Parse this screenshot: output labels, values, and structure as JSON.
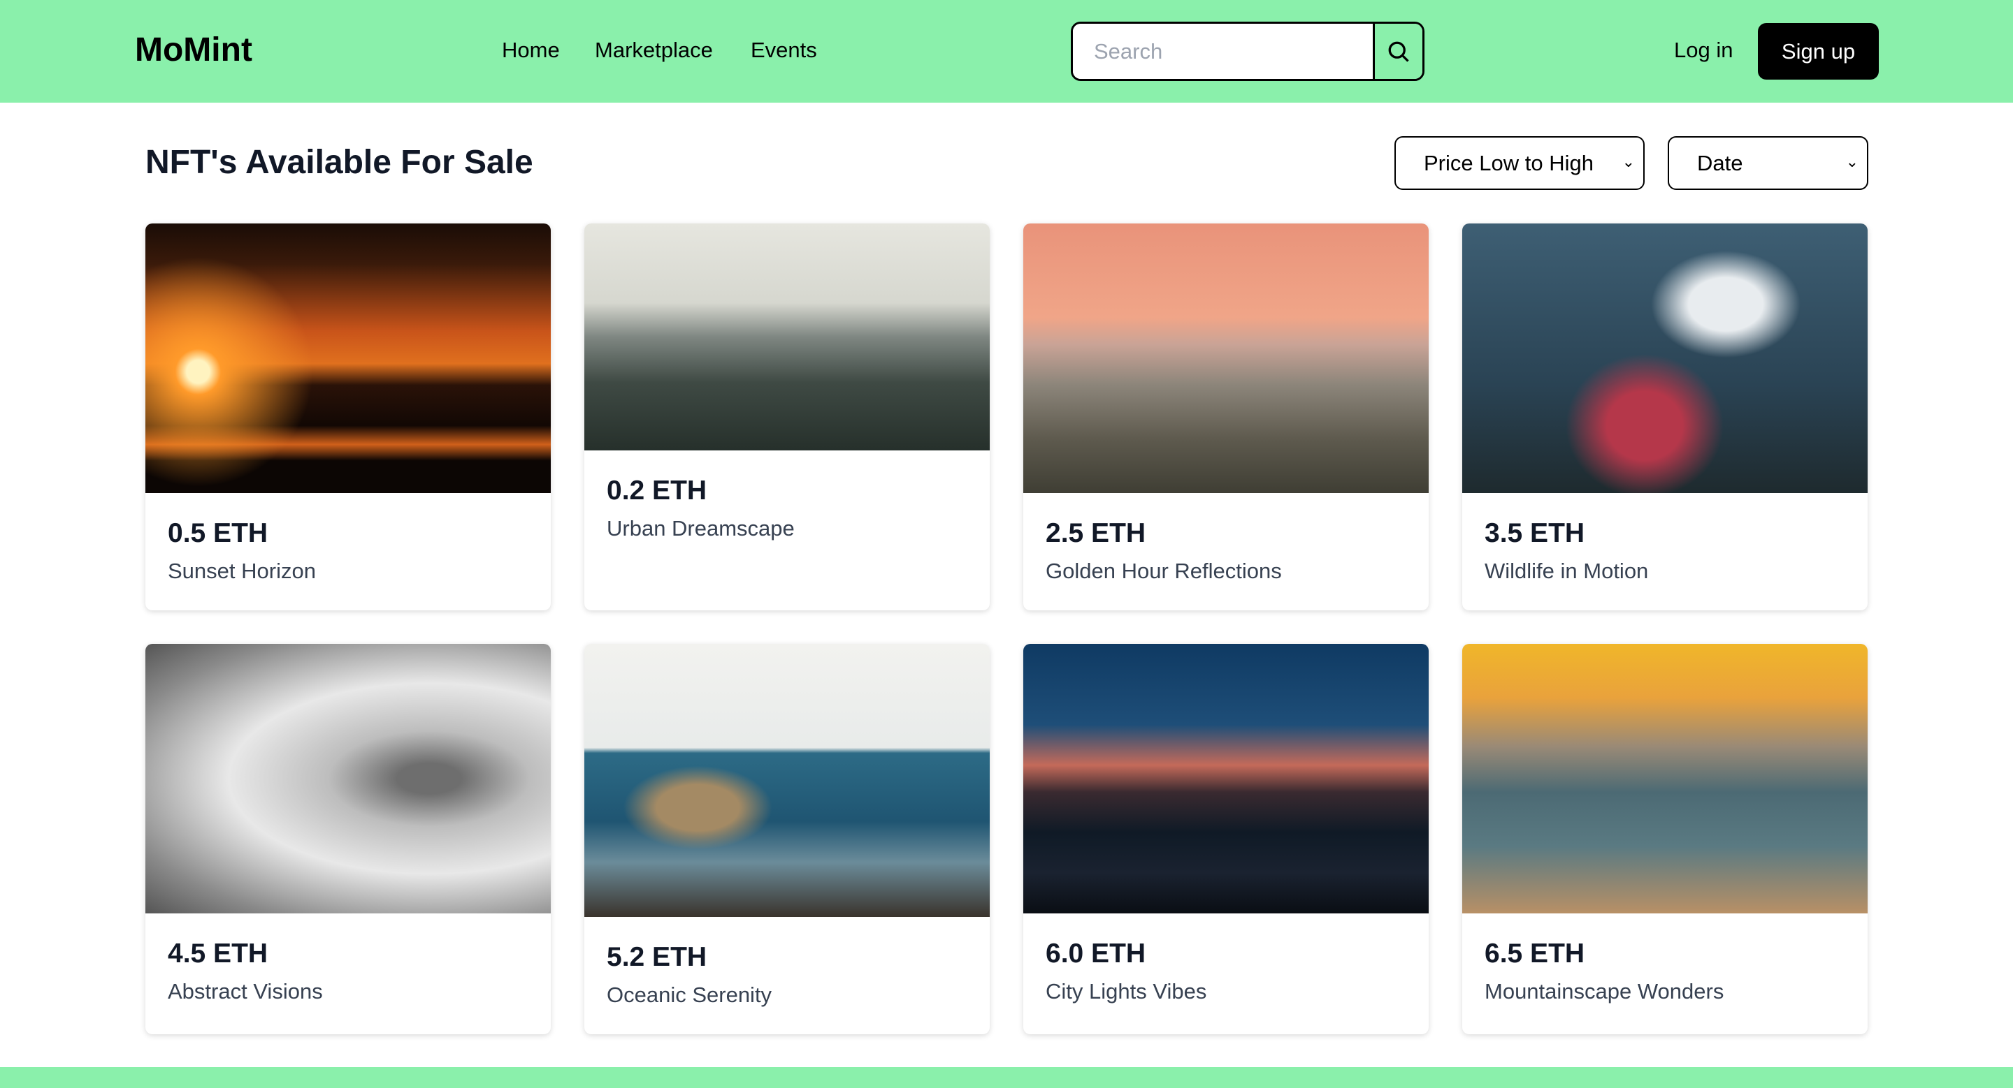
{
  "header": {
    "logo": "MoMint",
    "nav": [
      "Home",
      "Marketplace",
      "Events"
    ],
    "search_placeholder": "Search",
    "login": "Log in",
    "signup": "Sign up",
    "brand_color": "#8af0ab"
  },
  "main": {
    "title": "NFT's Available For Sale",
    "sort_select": "Price Low to High",
    "filter_select": "Date"
  },
  "cards": [
    {
      "price": "0.5 ETH",
      "name": "Sunset Horizon"
    },
    {
      "price": "0.2 ETH",
      "name": "Urban Dreamscape"
    },
    {
      "price": "2.5 ETH",
      "name": "Golden Hour Reflections"
    },
    {
      "price": "3.5 ETH",
      "name": "Wildlife in Motion"
    },
    {
      "price": "4.5 ETH",
      "name": "Abstract Visions"
    },
    {
      "price": "5.2 ETH",
      "name": "Oceanic Serenity"
    },
    {
      "price": "6.0 ETH",
      "name": "City Lights Vibes"
    },
    {
      "price": "6.5 ETH",
      "name": "Mountainscape Wonders"
    }
  ]
}
